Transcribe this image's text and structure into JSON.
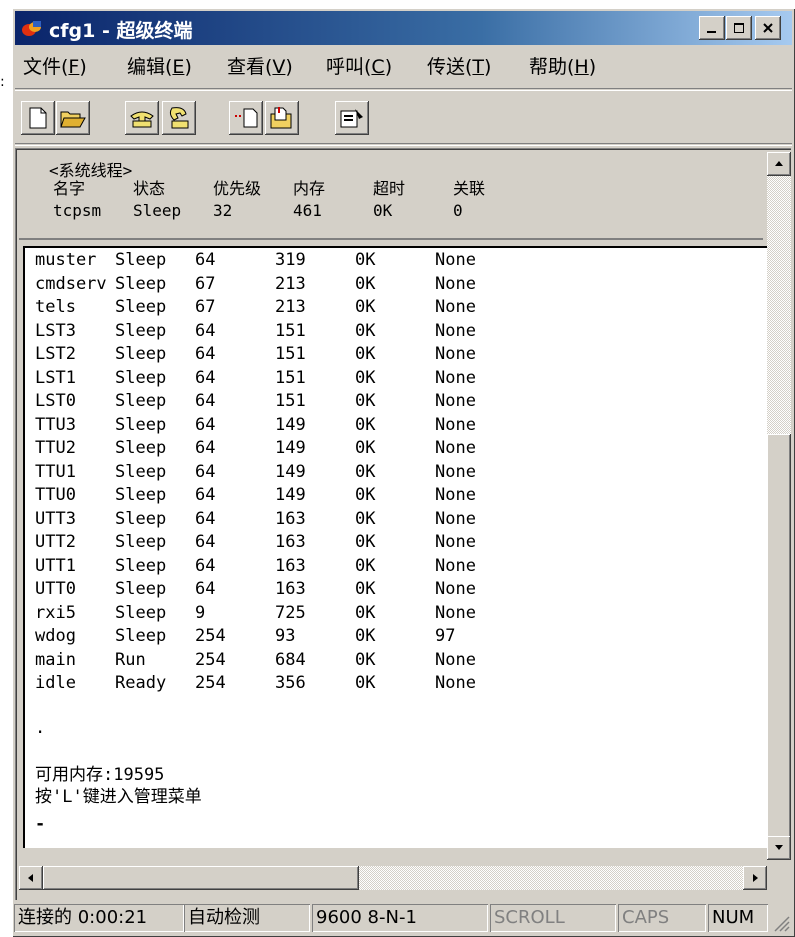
{
  "window": {
    "title": "cfg1 - 超级终端",
    "buttons": {
      "minimize": "_",
      "maximize": "□",
      "close": "×"
    }
  },
  "menu": [
    {
      "label": "文件(",
      "acc": "F",
      "tail": ")"
    },
    {
      "label": "编辑(",
      "acc": "E",
      "tail": ")"
    },
    {
      "label": "查看(",
      "acc": "V",
      "tail": ")"
    },
    {
      "label": "呼叫(",
      "acc": "C",
      "tail": ")"
    },
    {
      "label": "传送(",
      "acc": "T",
      "tail": ")"
    },
    {
      "label": "帮助(",
      "acc": "H",
      "tail": ")"
    }
  ],
  "toolbar": [
    "new-icon",
    "open-icon",
    "call-icon",
    "disconnect-icon",
    "send-icon",
    "receive-icon",
    "properties-icon"
  ],
  "header": {
    "line1": "<系统线程>",
    "columns": [
      "名字",
      "状态",
      "优先级",
      "内存",
      "超时",
      "关联"
    ],
    "row": [
      "tcpsm",
      "Sleep",
      "32",
      "461",
      "0K",
      "0"
    ]
  },
  "threads": [
    [
      "muster",
      "Sleep",
      "64",
      "319",
      "0K",
      "None"
    ],
    [
      "cmdserv",
      "Sleep",
      "67",
      "213",
      "0K",
      "None"
    ],
    [
      "tels",
      "Sleep",
      "67",
      "213",
      "0K",
      "None"
    ],
    [
      "LST3",
      "Sleep",
      "64",
      "151",
      "0K",
      "None"
    ],
    [
      "LST2",
      "Sleep",
      "64",
      "151",
      "0K",
      "None"
    ],
    [
      "LST1",
      "Sleep",
      "64",
      "151",
      "0K",
      "None"
    ],
    [
      "LST0",
      "Sleep",
      "64",
      "151",
      "0K",
      "None"
    ],
    [
      "TTU3",
      "Sleep",
      "64",
      "149",
      "0K",
      "None"
    ],
    [
      "TTU2",
      "Sleep",
      "64",
      "149",
      "0K",
      "None"
    ],
    [
      "TTU1",
      "Sleep",
      "64",
      "149",
      "0K",
      "None"
    ],
    [
      "TTU0",
      "Sleep",
      "64",
      "149",
      "0K",
      "None"
    ],
    [
      "UTT3",
      "Sleep",
      "64",
      "163",
      "0K",
      "None"
    ],
    [
      "UTT2",
      "Sleep",
      "64",
      "163",
      "0K",
      "None"
    ],
    [
      "UTT1",
      "Sleep",
      "64",
      "163",
      "0K",
      "None"
    ],
    [
      "UTT0",
      "Sleep",
      "64",
      "163",
      "0K",
      "None"
    ],
    [
      "rxi5",
      "Sleep",
      "9",
      "725",
      "0K",
      "None"
    ],
    [
      "wdog",
      "Sleep",
      "254",
      "93",
      "0K",
      "97"
    ],
    [
      "main",
      "Run",
      "254",
      "684",
      "0K",
      "None"
    ],
    [
      "idle",
      "Ready",
      "254",
      "356",
      "0K",
      "None"
    ]
  ],
  "terminal": {
    "dot": ".",
    "memory": "可用内存:19595",
    "hint": "按'L'键进入管理菜单",
    "cursor": "-"
  },
  "status": {
    "connected": "连接的 0:00:21",
    "detect": "自动检测",
    "params": "9600 8-N-1",
    "scroll": "SCROLL",
    "caps": "CAPS",
    "num": "NUM"
  },
  "colors": {
    "title_start": "#0a246a",
    "title_end": "#a6caf0",
    "face": "#d4d0c8"
  }
}
